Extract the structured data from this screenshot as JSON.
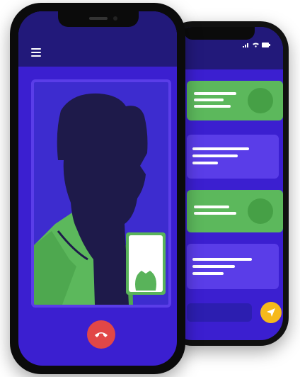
{
  "colors": {
    "screen_bg": "#3b1fd0",
    "topbar_bg": "#22197a",
    "accent_green": "#5cb85c",
    "accent_purple": "#5a3de8",
    "end_call_red": "#e14747",
    "send_yellow": "#f6b91b",
    "silhouette": "#1e1a4a"
  },
  "icons": {
    "menu": "hamburger-menu-icon",
    "end_call": "phone-hangup-icon",
    "send": "paper-plane-icon",
    "signal": "signal-icon",
    "wifi": "wifi-icon",
    "battery": "battery-icon"
  },
  "chat": {
    "messages": [
      {
        "type": "in",
        "lines": 3
      },
      {
        "type": "out",
        "lines": 3
      },
      {
        "type": "in",
        "lines": 2
      },
      {
        "type": "out",
        "lines": 3
      }
    ]
  }
}
